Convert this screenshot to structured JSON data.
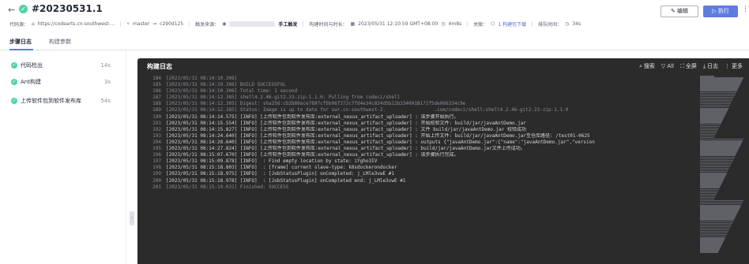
{
  "header": {
    "back_glyph": "←",
    "status_icon": "check-circle-icon",
    "title": "#20230531.1",
    "edit_label": "✎ 编辑",
    "run_label": "▷ 执行",
    "more_glyph": "⋮"
  },
  "meta": {
    "repo_label": "代码源：",
    "repo_url": "https://codearts.cn-southwest-...",
    "branch": "master",
    "commit": "c290d125",
    "trigger_label": "触发来源：",
    "trigger_value": "手工触发",
    "time_label": "构建时间与时长：",
    "time_value": "2023/05/31 12:10:59 GMT+08:00",
    "duration": "4m8s",
    "assoc_label": "关联：",
    "assoc_value": "1 构建包下载",
    "queue_label": "排队时间：",
    "queue_value": "34s"
  },
  "tabs": [
    {
      "label": "步骤日志",
      "active": true
    },
    {
      "label": "构建参数",
      "active": false
    }
  ],
  "steps": [
    {
      "name": "代码检出",
      "duration": "14s"
    },
    {
      "name": "Ant构建",
      "duration": "3s"
    },
    {
      "name": "上传软件包到软件发布库",
      "duration": "54s"
    }
  ],
  "console": {
    "title": "构建日志",
    "tools": {
      "search": "搜索",
      "all": "All",
      "fullscreen": "全屏",
      "log": "日志",
      "more": "更多"
    }
  },
  "log": [
    {
      "n": "184",
      "t": "[2023/05/31 08:14:10.306]",
      "bright": false
    },
    {
      "n": "185",
      "t": "[2023/05/31 08:14:10.306] BUILD SUCCESSFUL",
      "bright": false
    },
    {
      "n": "186",
      "t": "[2023/05/31 08:14:10.306] Total time: 1 second",
      "bright": false
    },
    {
      "n": "187",
      "t": "[2023/05/31 08:14:12.385] shell4.2.46-git2.23-zip-1.1.0: Pulling from codeci/shell",
      "bright": false
    },
    {
      "n": "188",
      "t": "[2023/05/31 08:14:12.385] Digest: sha256:cb2b80ace7897cf5b06f372c7fd4e34c834d5b22b334001B171f5de066334c9e",
      "bright": false
    },
    {
      "n": "189",
      "t": "[2023/05/31 08:14:12.385] Status: Image is up to date for swr.cn-southwest-2.                 .com/codeci/shell:shell4.2.46-git2.23-zip-1.1.0",
      "bright": false
    },
    {
      "n": "190",
      "t": "[2023/05/31 08:14:14.575] [INFO] [上传软件包到软件发布库:external_nexus_artifact_uploader] : 该步骤开始执行。",
      "bright": true
    },
    {
      "n": "191",
      "t": "[2023/05/31 08:14:15.554] [INFO] [上传软件包到软件发布库:external_nexus_artifact_uploader] : 开始校验文件: build/jar/javaAntDemo.jar",
      "bright": true
    },
    {
      "n": "192",
      "t": "[2023/05/31 08:14:15.827] [INFO] [上传软件包到软件发布库:external_nexus_artifact_uploader] : 文件 build/jar/javaAntDemo.jar 校验成功",
      "bright": true
    },
    {
      "n": "193",
      "t": "[2023/05/31 08:14:24.640] [INFO] [上传软件包到软件发布库:external_nexus_artifact_uploader] : 开始上传文件: build/jar/javaAntDemo.jar至仓库路径: /test01-0625",
      "bright": true
    },
    {
      "n": "194",
      "t": "[2023/05/31 08:14:28.640] [INFO] [上传软件包到软件发布库:external_nexus_artifact_uploader] : outputs {\"javaAntDemo.jar\":{\"name\":\"javaAntDemo.jar\",\"version",
      "bright": true
    },
    {
      "n": "195",
      "t": "[2023/05/31 08:14:27.824] [INFO] [上传软件包到软件发布库:external_nexus_artifact_uploader] : build/jar/javaAntDemo.jar文件上传成功。",
      "bright": true
    },
    {
      "n": "196",
      "t": "[2023/05/31 08:15:07.670] [INFO] [上传软件包到软件发布库:external_nexus_artifact_uploader] : 该步骤执行完成。",
      "bright": true
    },
    {
      "n": "197",
      "t": "[2023/05/31 08:15:09.878] [INFO]  : Find empty location by state: iYgho3IV",
      "bright": true
    },
    {
      "n": "198",
      "t": "[2023/05/31 08:15:18.803] [INFO]  : [frame] current slave-type: k8sdockerondocker",
      "bright": true
    },
    {
      "n": "199",
      "t": "[2023/05/31 08:15:18.975] [INFO]  : [JobStatusPlugin] onCompleted: j_LMle3vwE #1",
      "bright": true
    },
    {
      "n": "200",
      "t": "[2023/05/31 08:15:18.978] [INFO]  : [JobStatusPlugin] onCompleted end: j_LMle3vwE #1",
      "bright": true
    },
    {
      "n": "201",
      "t": "[2023/05/31 08:15:19.031] Finished: SUCCESS",
      "bright": false
    }
  ],
  "colors": {
    "accent": "#5e7ce0",
    "success": "#50d4ab",
    "console_bg": "#2b2b2b"
  }
}
